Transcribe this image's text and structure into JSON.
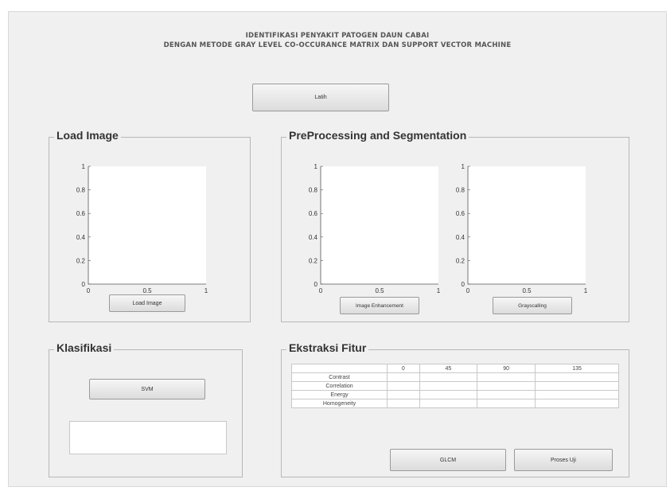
{
  "header": {
    "title_line1": "IDENTIFIKASI PENYAKIT PATOGEN DAUN CABAI",
    "title_line2": "DENGAN METODE GRAY LEVEL CO-OCCURANCE MATRIX DAN SUPPORT VECTOR MACHINE"
  },
  "train_button": "Latih",
  "load_panel": {
    "title": "Load Image",
    "button": "Load Image"
  },
  "preprocess_panel": {
    "title": "PreProcessing and Segmentation",
    "enhance_button": "Image Enhancement",
    "gray_button": "Grayscalling"
  },
  "axes": {
    "y_ticks": [
      "0",
      "0.2",
      "0.4",
      "0.6",
      "0.8",
      "1"
    ],
    "x_ticks": [
      "0",
      "0.5",
      "1"
    ],
    "x_range": [
      0,
      1
    ],
    "y_range": [
      0,
      1
    ]
  },
  "klasifikasi_panel": {
    "title": "Klasifikasi",
    "svm_button": "SVM",
    "result_value": ""
  },
  "ekstraksi_panel": {
    "title": "Ekstraksi Fitur",
    "columns": [
      "",
      "0",
      "45",
      "90",
      "135"
    ],
    "rows": [
      {
        "label": "Contrast",
        "values": [
          "",
          "",
          "",
          ""
        ]
      },
      {
        "label": "Correlation",
        "values": [
          "",
          "",
          "",
          ""
        ]
      },
      {
        "label": "Energy",
        "values": [
          "",
          "",
          "",
          ""
        ]
      },
      {
        "label": "Homogeneity",
        "values": [
          "",
          "",
          "",
          ""
        ]
      }
    ],
    "glcm_button": "GLCM",
    "proses_button": "Proses Uji"
  }
}
